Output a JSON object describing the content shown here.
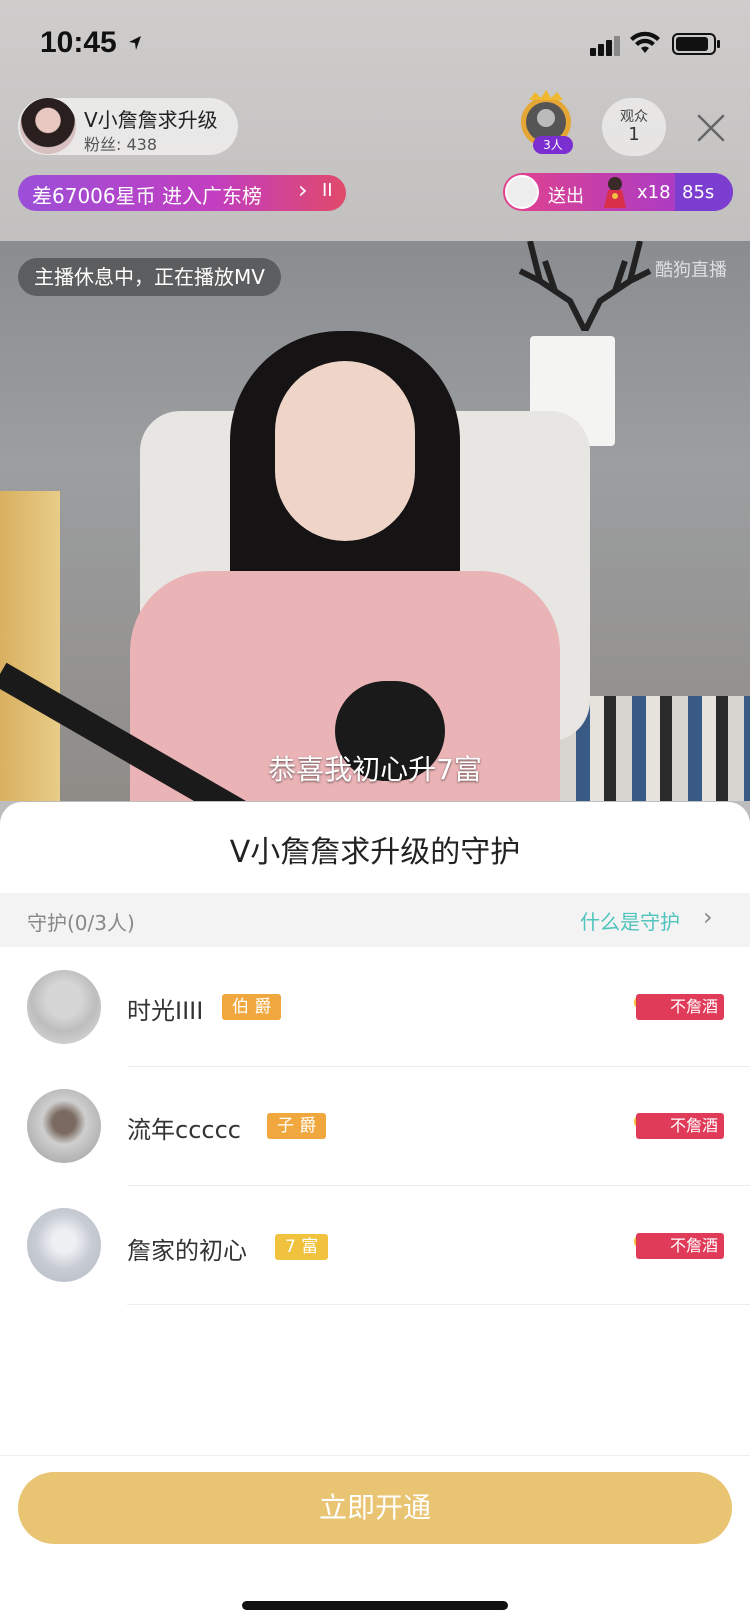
{
  "status_bar": {
    "time": "10:45"
  },
  "host": {
    "name": "V小詹詹求升级",
    "fans": "粉丝: 438"
  },
  "guard_badge": {
    "count": "3人"
  },
  "viewers": {
    "label": "观众",
    "count": "1"
  },
  "rank_banner": {
    "text": "差67006星币 进入广东榜"
  },
  "gift_banner": {
    "send_label": "送出",
    "multiplier": "x18",
    "timer": "85s"
  },
  "video": {
    "notice": "主播休息中，正在播放MV",
    "watermark": "酷狗直播",
    "subtitle": "恭喜我初心升7富"
  },
  "sheet": {
    "title": "V小詹詹求升级的守护",
    "guard_header": "守护(0/3人)",
    "help_link": "什么是守护",
    "rows": [
      {
        "name": "时光IIII",
        "badge": "伯 爵",
        "badge_color": "#f0a83e",
        "tag": "不詹酒"
      },
      {
        "name": "流年ccccc",
        "badge": "子 爵",
        "badge_color": "#f0a83e",
        "tag": "不詹酒"
      },
      {
        "name": "詹家的初心",
        "badge": "7 富",
        "badge_color": "#f0c23e",
        "tag": "不詹酒"
      }
    ],
    "open_button": "立即开通"
  },
  "colors": {
    "accent_gold": "#e9c472",
    "link_teal": "#4fc4bd",
    "tag_red": "#e03b58"
  }
}
